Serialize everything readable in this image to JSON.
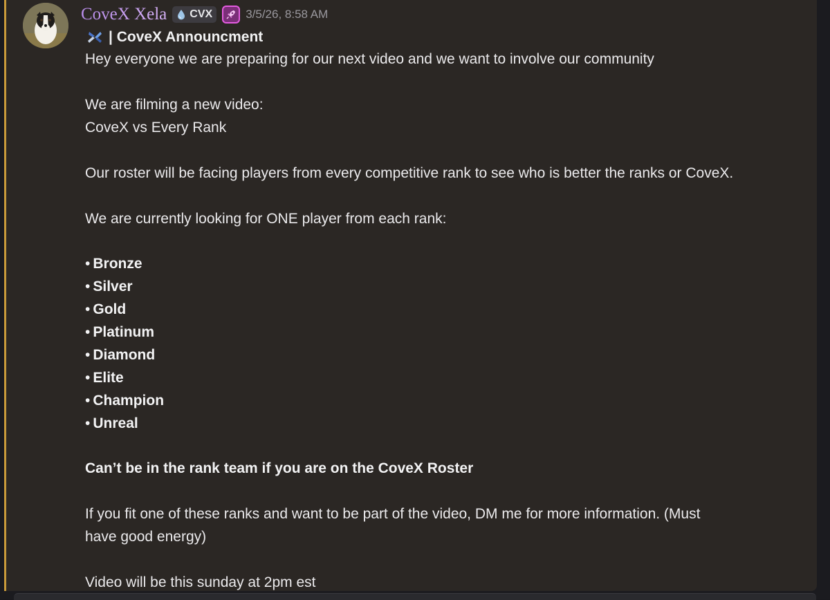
{
  "author": {
    "name": "CoveX Xela",
    "tag": "CVX",
    "timestamp": "3/5/26, 8:58 AM"
  },
  "icons": {
    "avatar": "dog-avatar",
    "tag_icon": "water-drop-icon",
    "booster": "rocket-icon",
    "title_emoji": "covex-logo-icon"
  },
  "colors": {
    "username": "#c59cf0",
    "left_accent": "#c99a3a",
    "booster_border": "#e45ce1"
  },
  "message": {
    "title": "| CoveX Announcment",
    "intro": "Hey everyone we are preparing for our next video and we want to involve our community",
    "filming_line1": "We are filming a new video:",
    "filming_line2": "CoveX vs Every Rank",
    "roster_line": "Our roster will be facing players from every competitive rank to see who is better the ranks or CoveX.",
    "looking_line": "We are currently looking for ONE player from each rank:",
    "ranks": [
      "Bronze",
      "Silver",
      "Gold",
      "Platinum",
      "Diamond",
      "Elite",
      "Champion",
      "Unreal"
    ],
    "bullet": "•",
    "rule": "Can’t be in the rank team if you are on the CoveX Roster",
    "contact_line1": "If you fit one of these ranks and want to be part of the video, DM me for more information. (Must",
    "contact_line2": "have good energy)",
    "schedule": "Video will be this sunday at 2pm est"
  }
}
